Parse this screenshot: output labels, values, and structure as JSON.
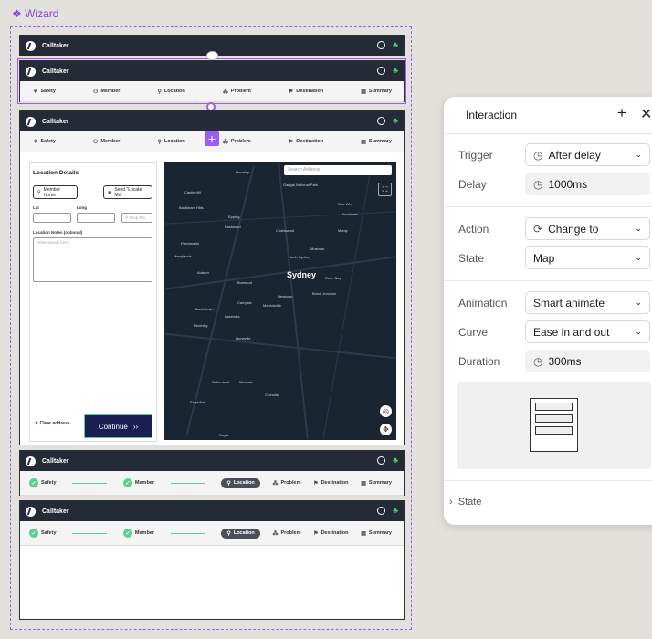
{
  "canvas": {
    "wizard_label": "❖ Wizard"
  },
  "app": {
    "name": "Calltaker"
  },
  "steps": [
    "Safety",
    "Member",
    "Location",
    "Problem",
    "Destination",
    "Summary"
  ],
  "location_details": {
    "title": "Location Details",
    "member_home": "Member Home",
    "send_locate": "Send \"Locate Me\"",
    "lat_label": "Lat",
    "long_label": "Long",
    "drop_pin": "Drop Pin",
    "notes_label": "Location Notes (optional)",
    "notes_placeholder": "Enter details here",
    "clear": "✕ Clear address",
    "continue": "Continue"
  },
  "map": {
    "search_placeholder": "Search Address",
    "city": "Sydney",
    "places": [
      "Hornsby",
      "Castle Hill",
      "Baulkham Hills",
      "Epping",
      "Eastwood",
      "Chatswood",
      "Parramatta",
      "Merrylands",
      "Auburn",
      "Burwood",
      "North Sydney",
      "Mosman",
      "Manly",
      "Rose Bay",
      "Bondi Junction",
      "Newtown",
      "Marrickville",
      "Campsie",
      "Bankstown",
      "Hurstville",
      "Sutherland",
      "Miranda",
      "Cronulla",
      "Engadine",
      "Revesby",
      "Lakemba",
      "Brookvale",
      "Dee Why",
      "Garigal National Park",
      "Royal"
    ]
  },
  "interaction": {
    "title": "Interaction",
    "trigger_label": "Trigger",
    "trigger_value": "After delay",
    "delay_label": "Delay",
    "delay_value": "1000ms",
    "action_label": "Action",
    "action_value": "Change to",
    "state_label": "State",
    "state_value": "Map",
    "animation_label": "Animation",
    "animation_value": "Smart animate",
    "curve_label": "Curve",
    "curve_value": "Ease in and out",
    "duration_label": "Duration",
    "duration_value": "300ms",
    "state_section": "State"
  },
  "colors": {
    "accent": "#9d5cf5",
    "header": "#252b36",
    "done": "#5ccf95",
    "continue": "#1b1e53"
  }
}
